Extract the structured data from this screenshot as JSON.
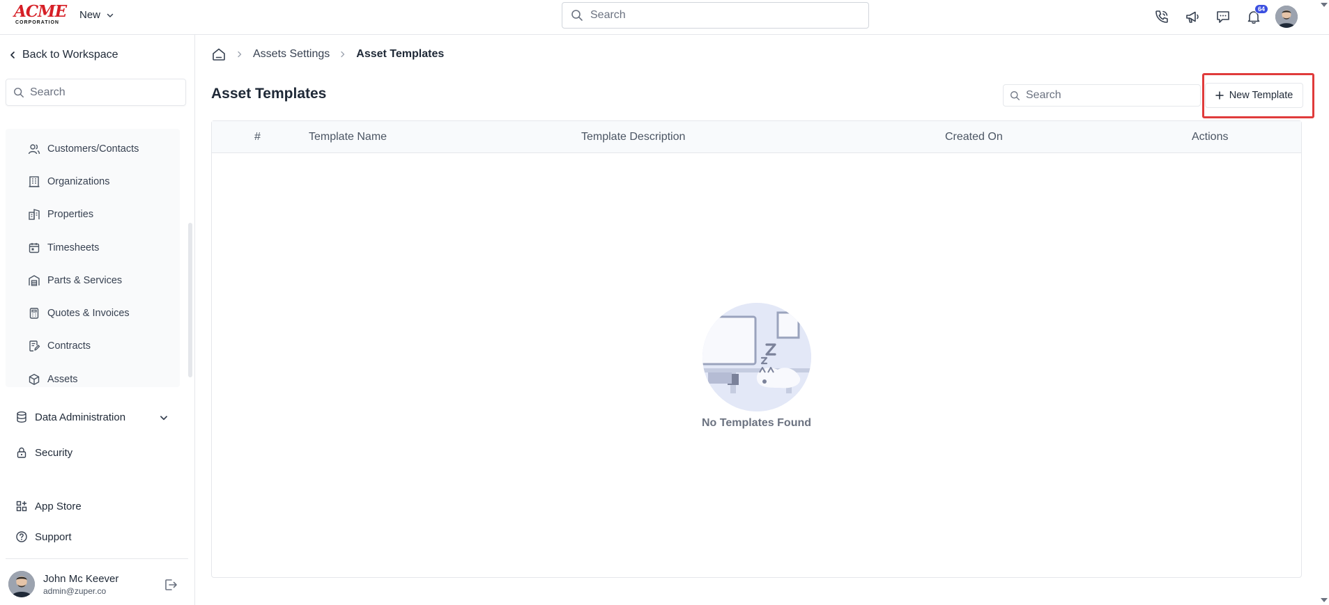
{
  "app": {
    "logo": {
      "main": "ACME",
      "sub": "CORPORATION"
    },
    "new_menu_label": "New"
  },
  "top_search": {
    "placeholder": "Search"
  },
  "notifications": {
    "badge_count": "64"
  },
  "sidebar": {
    "back_label": "Back to Workspace",
    "search_placeholder": "Search",
    "sub_items": [
      {
        "label": "Customers/Contacts",
        "icon": "users-icon"
      },
      {
        "label": "Organizations",
        "icon": "building-icon"
      },
      {
        "label": "Properties",
        "icon": "buildings-icon"
      },
      {
        "label": "Timesheets",
        "icon": "calendar-icon"
      },
      {
        "label": "Parts & Services",
        "icon": "warehouse-icon"
      },
      {
        "label": "Quotes & Invoices",
        "icon": "calculator-icon"
      },
      {
        "label": "Contracts",
        "icon": "contract-icon"
      },
      {
        "label": "Assets",
        "icon": "cube-icon"
      }
    ],
    "items": [
      {
        "label": "Data Administration",
        "icon": "database-icon"
      },
      {
        "label": "Security",
        "icon": "lock-icon"
      },
      {
        "label": "App Store",
        "icon": "apps-icon"
      },
      {
        "label": "Support",
        "icon": "help-icon"
      }
    ],
    "user": {
      "name": "John Mc Keever",
      "email": "admin@zuper.co"
    }
  },
  "breadcrumb": {
    "parent": "Assets Settings",
    "current": "Asset Templates"
  },
  "page": {
    "title": "Asset Templates",
    "search_placeholder": "Search",
    "new_button_label": "New Template"
  },
  "table": {
    "columns": [
      "#",
      "Template Name",
      "Template Description",
      "Created On",
      "Actions"
    ],
    "rows": [],
    "empty_message": "No Templates Found"
  },
  "colors": {
    "brand_red": "#d61f26",
    "badge_blue": "#3b4fe0",
    "highlight_red": "#e03b3b"
  }
}
